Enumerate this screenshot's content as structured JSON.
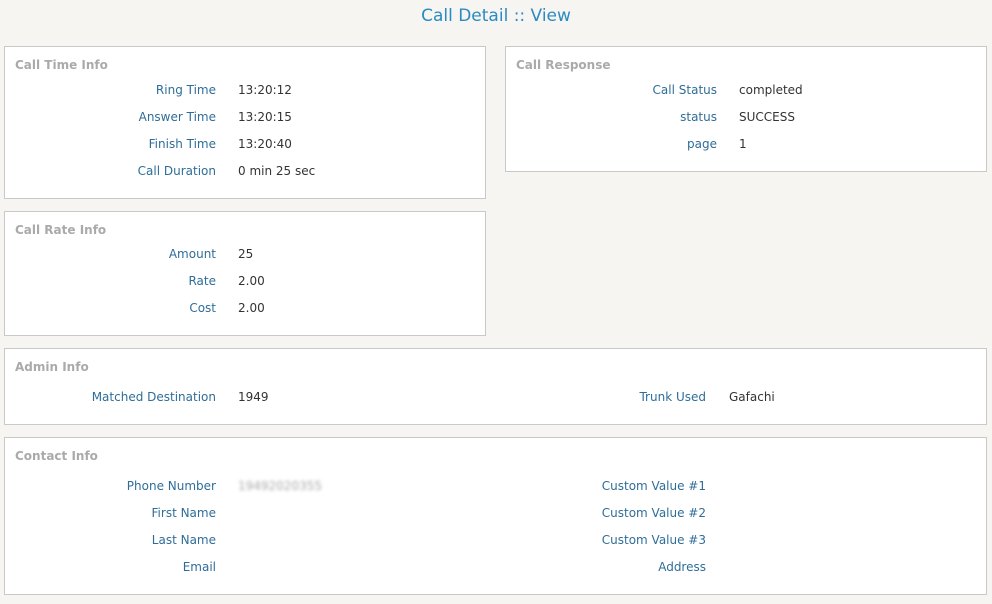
{
  "page": {
    "title": "Call Detail :: View"
  },
  "call_time_info": {
    "title": "Call Time Info",
    "rows": [
      {
        "label": "Ring Time",
        "value": "13:20:12"
      },
      {
        "label": "Answer Time",
        "value": "13:20:15"
      },
      {
        "label": "Finish Time",
        "value": "13:20:40"
      },
      {
        "label": "Call Duration",
        "value": "0 min 25 sec"
      }
    ]
  },
  "call_response": {
    "title": "Call Response",
    "rows": [
      {
        "label": "Call Status",
        "value": "completed"
      },
      {
        "label": "status",
        "value": "SUCCESS"
      },
      {
        "label": "page",
        "value": "1"
      }
    ]
  },
  "call_rate_info": {
    "title": "Call Rate Info",
    "rows": [
      {
        "label": "Amount",
        "value": "25"
      },
      {
        "label": "Rate",
        "value": "2.00"
      },
      {
        "label": "Cost",
        "value": "2.00"
      }
    ]
  },
  "admin_info": {
    "title": "Admin Info",
    "matched_destination": {
      "label": "Matched Destination",
      "value": "1949"
    },
    "trunk_used": {
      "label": "Trunk Used",
      "value": "Gafachi"
    }
  },
  "contact_info": {
    "title": "Contact Info",
    "left": [
      {
        "label": "Phone Number",
        "value": "19492020355"
      },
      {
        "label": "First Name",
        "value": ""
      },
      {
        "label": "Last Name",
        "value": ""
      },
      {
        "label": "Email",
        "value": ""
      }
    ],
    "right": [
      {
        "label": "Custom Value #1",
        "value": ""
      },
      {
        "label": "Custom Value #2",
        "value": ""
      },
      {
        "label": "Custom Value #3",
        "value": ""
      },
      {
        "label": "Address",
        "value": ""
      }
    ]
  }
}
